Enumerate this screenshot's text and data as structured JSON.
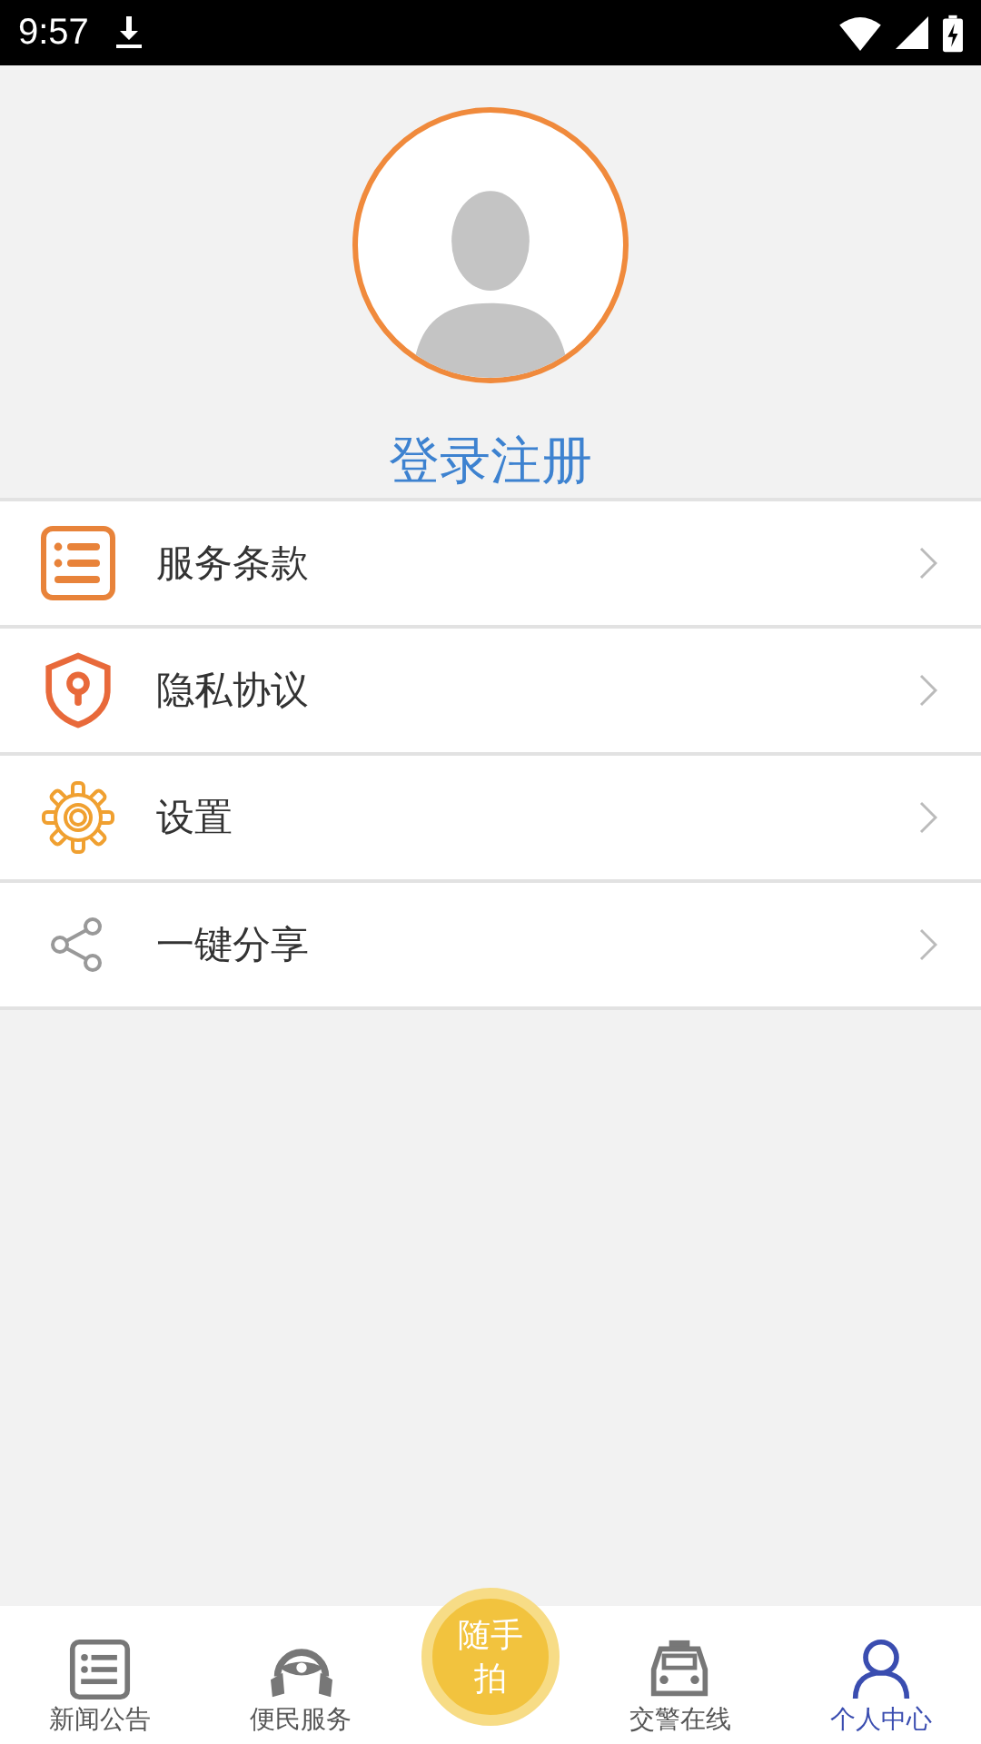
{
  "status_bar": {
    "time": "9:57"
  },
  "profile": {
    "login_label": "登录注册"
  },
  "menu": [
    {
      "kind": "terms",
      "label": "服务条款"
    },
    {
      "kind": "privacy",
      "label": "隐私协议"
    },
    {
      "kind": "settings",
      "label": "设置"
    },
    {
      "kind": "share",
      "label": "一键分享"
    }
  ],
  "bottom_nav": [
    {
      "kind": "news",
      "label": "新闻公告",
      "selected": false
    },
    {
      "kind": "service",
      "label": "便民服务",
      "selected": false
    },
    {
      "kind": "capture",
      "label": "随手拍",
      "selected": false
    },
    {
      "kind": "police",
      "label": "交警在线",
      "selected": false
    },
    {
      "kind": "profile",
      "label": "个人中心",
      "selected": true
    }
  ]
}
